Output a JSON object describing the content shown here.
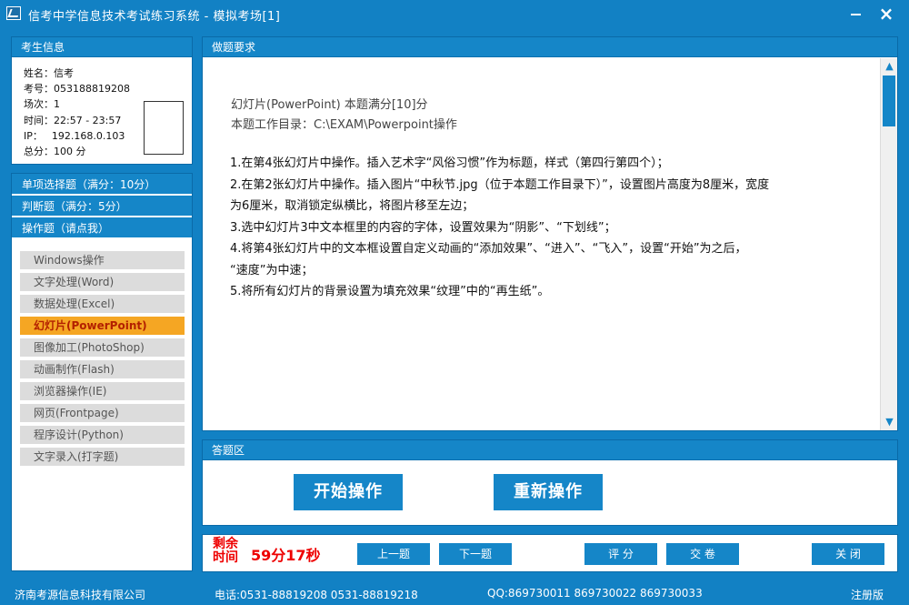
{
  "window": {
    "title": "信考中学信息技术考试练习系统 - 模拟考场[1]",
    "minimize": "",
    "close": "×"
  },
  "student": {
    "header": "考生信息",
    "rows": [
      {
        "label": "姓名：",
        "value": "信考"
      },
      {
        "label": "考号：",
        "value": "053188819208"
      },
      {
        "label": "场次：",
        "value": "1"
      },
      {
        "label": "时间：",
        "value": "22:57 - 23:57"
      },
      {
        "label": "IP：",
        "value": "192.168.0.103"
      },
      {
        "label": "总分：",
        "value": "100 分"
      }
    ]
  },
  "question_types": {
    "single": "单项选择题（满分：10分）",
    "judge": "判断题（满分：5分）",
    "ops": "操作题（请点我）"
  },
  "ops_items": [
    "Windows操作",
    "文字处理(Word)",
    "数据处理(Excel)",
    "幻灯片(PowerPoint)",
    "图像加工(PhotoShop)",
    "动画制作(Flash)",
    "浏览器操作(IE)",
    "网页(Frontpage)",
    "程序设计(Python)",
    "文字录入(打字题)"
  ],
  "active_op_index": 3,
  "requirements": {
    "header": "做题要求",
    "line1": "幻灯片(PowerPoint)  本题满分[10]分",
    "line2": "本题工作目录：C:\\EXAM\\Powerpoint操作",
    "steps": [
      "1.在第4张幻灯片中操作。插入艺术字“风俗习惯”作为标题，样式（第四行第四个）；",
      "2.在第2张幻灯片中操作。插入图片“中秋节.jpg（位于本题工作目录下）”，设置图片高度为8厘米，宽度",
      "为6厘米，取消锁定纵横比，将图片移至左边；",
      "3.选中幻灯片3中文本框里的内容的字体，设置效果为“阴影”、“下划线”；",
      "4.将第4张幻灯片中的文本框设置自定义动画的“添加效果”、“进入”、“飞入”，设置“开始”为之后，",
      "“速度”为中速；",
      "5.将所有幻灯片的背景设置为填充效果“纹理”中的“再生纸”。"
    ]
  },
  "answer": {
    "header": "答题区",
    "start": "开始操作",
    "redo": "重新操作"
  },
  "controls": {
    "timer_label": "剩余时间",
    "timer_value": "59分17秒",
    "prev": "上一题",
    "next": "下一题",
    "grade": "评 分",
    "submit": "交 卷",
    "close": "关 闭"
  },
  "footer": {
    "company": "济南考源信息科技有限公司",
    "phone": "电话:0531-88819208  0531-88819218",
    "qq": "QQ:869730011  869730022  869730033",
    "register": "注册版"
  },
  "colors": {
    "primary": "#1586c8",
    "active": "#f5a623",
    "timer": "#e00000"
  }
}
